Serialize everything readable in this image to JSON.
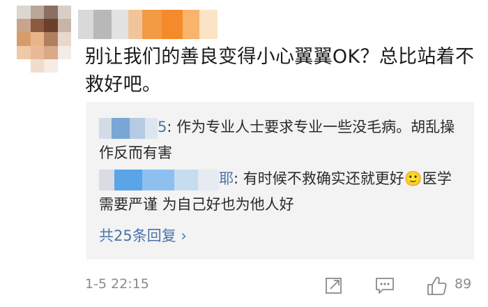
{
  "comment": {
    "text": "别让我们的善良变得小心翼翼OK？总比站着不救好吧。"
  },
  "replies": [
    {
      "name_suffix": "5",
      "text": "作为专业人士要求专业一些没毛病。胡乱操作反而有害"
    },
    {
      "name_suffix": "耶",
      "text": "有时候不救确实还就更好🙂医学需要严谨 为自己好也为他人好"
    }
  ],
  "more_replies": "共25条回复 ›",
  "footer": {
    "timestamp": "1-5 22:15",
    "like_count": "89",
    "icons": [
      "share-icon",
      "comment-icon",
      "like-icon"
    ]
  },
  "colors": {
    "link": "#4a74a8",
    "reply_bg": "#f3f3f3",
    "meta": "#8a8a8a"
  }
}
